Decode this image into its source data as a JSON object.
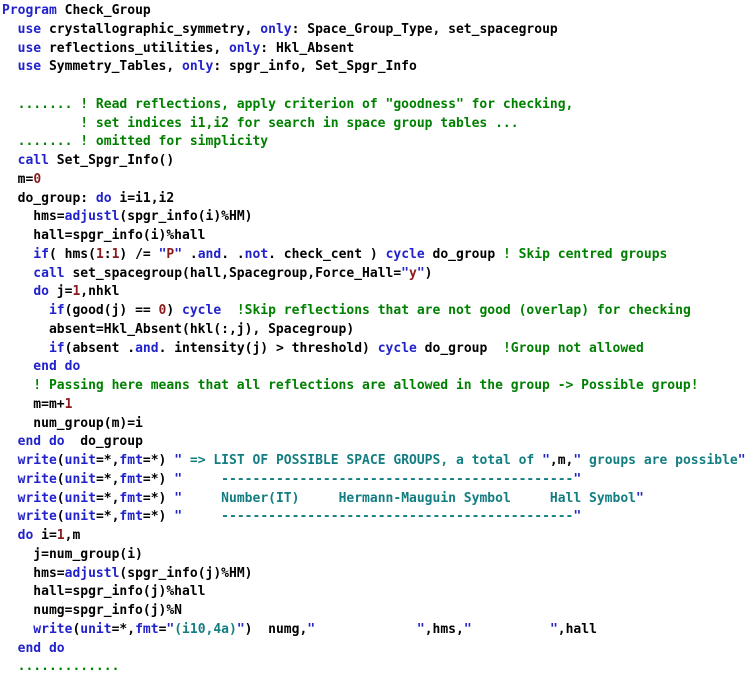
{
  "window": {
    "title": "Check_Group",
    "language": "Fortran",
    "background_color": "#ffffff"
  },
  "theme": {
    "keyword_color": "#2222cc",
    "comment_color": "#008000",
    "number_color": "#8b1a1a",
    "string_literal_color": "#8b1a1a",
    "format_string_color": "#127e82",
    "plain_text_color": "#000000",
    "quote_color": "#2222cc"
  },
  "code": {
    "line_count": 29,
    "lines": [
      [
        {
          "t": "kw",
          "s": "Program"
        },
        {
          "t": "plain",
          "s": " Check_Group"
        }
      ],
      [
        {
          "t": "plain",
          "s": "  "
        },
        {
          "t": "kw",
          "s": "use"
        },
        {
          "t": "plain",
          "s": " crystallographic_symmetry, "
        },
        {
          "t": "kw",
          "s": "only"
        },
        {
          "t": "plain",
          "s": ": Space_Group_Type, set_spacegroup"
        }
      ],
      [
        {
          "t": "plain",
          "s": "  "
        },
        {
          "t": "kw",
          "s": "use"
        },
        {
          "t": "plain",
          "s": " reflections_utilities, "
        },
        {
          "t": "kw",
          "s": "only"
        },
        {
          "t": "plain",
          "s": ": Hkl_Absent"
        }
      ],
      [
        {
          "t": "plain",
          "s": "  "
        },
        {
          "t": "kw",
          "s": "use"
        },
        {
          "t": "plain",
          "s": " Symmetry_Tables, "
        },
        {
          "t": "kw",
          "s": "only"
        },
        {
          "t": "plain",
          "s": ": spgr_info, Set_Spgr_Info"
        }
      ],
      [
        {
          "t": "plain",
          "s": ""
        }
      ],
      [
        {
          "t": "cmt",
          "s": "  ....... ! Read reflections, apply criterion of \"goodness\" for checking,"
        }
      ],
      [
        {
          "t": "cmt",
          "s": "          ! set indices i1,i2 for search in space group tables ..."
        }
      ],
      [
        {
          "t": "cmt",
          "s": "  ....... ! omitted for simplicity"
        }
      ],
      [
        {
          "t": "kw",
          "s": "  call"
        },
        {
          "t": "plain",
          "s": " Set_Spgr_Info()"
        }
      ],
      [
        {
          "t": "plain",
          "s": "  m="
        },
        {
          "t": "num",
          "s": "0"
        }
      ],
      [
        {
          "t": "plain",
          "s": "  do_group: "
        },
        {
          "t": "kw",
          "s": "do"
        },
        {
          "t": "plain",
          "s": " i=i1,i2"
        }
      ],
      [
        {
          "t": "plain",
          "s": "    hms="
        },
        {
          "t": "kw",
          "s": "adjustl"
        },
        {
          "t": "plain",
          "s": "(spgr_info(i)%HM)"
        }
      ],
      [
        {
          "t": "plain",
          "s": "    hall=spgr_info(i)%hall"
        }
      ],
      [
        {
          "t": "kw",
          "s": "    if"
        },
        {
          "t": "plain",
          "s": "( hms("
        },
        {
          "t": "num",
          "s": "1"
        },
        {
          "t": "plain",
          "s": ":"
        },
        {
          "t": "num",
          "s": "1"
        },
        {
          "t": "plain",
          "s": ") /= "
        },
        {
          "t": "strq",
          "s": "\""
        },
        {
          "t": "str",
          "s": "P"
        },
        {
          "t": "strq",
          "s": "\""
        },
        {
          "t": "plain",
          "s": " ."
        },
        {
          "t": "kw",
          "s": "and"
        },
        {
          "t": "plain",
          "s": ". ."
        },
        {
          "t": "kw",
          "s": "not"
        },
        {
          "t": "plain",
          "s": ". check_cent ) "
        },
        {
          "t": "kw",
          "s": "cycle"
        },
        {
          "t": "plain",
          "s": " do_group "
        },
        {
          "t": "cmt",
          "s": "! Skip centred groups"
        }
      ],
      [
        {
          "t": "kw",
          "s": "    call"
        },
        {
          "t": "plain",
          "s": " set_spacegroup(hall,Spacegroup,Force_Hall="
        },
        {
          "t": "strq",
          "s": "\""
        },
        {
          "t": "str",
          "s": "y"
        },
        {
          "t": "strq",
          "s": "\""
        },
        {
          "t": "plain",
          "s": ")"
        }
      ],
      [
        {
          "t": "plain",
          "s": "    "
        },
        {
          "t": "kw",
          "s": "do"
        },
        {
          "t": "plain",
          "s": " j="
        },
        {
          "t": "num",
          "s": "1"
        },
        {
          "t": "plain",
          "s": ",nhkl"
        }
      ],
      [
        {
          "t": "kw",
          "s": "      if"
        },
        {
          "t": "plain",
          "s": "(good(j) == "
        },
        {
          "t": "num",
          "s": "0"
        },
        {
          "t": "plain",
          "s": ") "
        },
        {
          "t": "kw",
          "s": "cycle"
        },
        {
          "t": "plain",
          "s": "  "
        },
        {
          "t": "cmt",
          "s": "!Skip reflections that are not good (overlap) for checking"
        }
      ],
      [
        {
          "t": "plain",
          "s": "      absent=Hkl_Absent(hkl(:,j), Spacegroup)"
        }
      ],
      [
        {
          "t": "kw",
          "s": "      if"
        },
        {
          "t": "plain",
          "s": "(absent ."
        },
        {
          "t": "kw",
          "s": "and"
        },
        {
          "t": "plain",
          "s": ". intensity(j) > threshold) "
        },
        {
          "t": "kw",
          "s": "cycle"
        },
        {
          "t": "plain",
          "s": " do_group  "
        },
        {
          "t": "cmt",
          "s": "!Group not allowed"
        }
      ],
      [
        {
          "t": "kw",
          "s": "    end do"
        }
      ],
      [
        {
          "t": "cmt",
          "s": "    ! Passing here means that all reflections are allowed in the group -> Possible group!"
        }
      ],
      [
        {
          "t": "plain",
          "s": "    m=m+"
        },
        {
          "t": "num",
          "s": "1"
        }
      ],
      [
        {
          "t": "plain",
          "s": "    num_group(m)=i"
        }
      ],
      [
        {
          "t": "kw",
          "s": "  end do"
        },
        {
          "t": "plain",
          "s": "  do_group"
        }
      ],
      [
        {
          "t": "kw",
          "s": "  write"
        },
        {
          "t": "plain",
          "s": "("
        },
        {
          "t": "kw",
          "s": "unit"
        },
        {
          "t": "plain",
          "s": "=*,"
        },
        {
          "t": "kw",
          "s": "fmt"
        },
        {
          "t": "plain",
          "s": "=*) "
        },
        {
          "t": "strq",
          "s": "\""
        },
        {
          "t": "fstr",
          "s": " => LIST OF POSSIBLE SPACE GROUPS, a total of "
        },
        {
          "t": "strq",
          "s": "\""
        },
        {
          "t": "plain",
          "s": ",m,"
        },
        {
          "t": "strq",
          "s": "\""
        },
        {
          "t": "fstr",
          "s": " groups are possible"
        },
        {
          "t": "strq",
          "s": "\""
        }
      ],
      [
        {
          "t": "kw",
          "s": "  write"
        },
        {
          "t": "plain",
          "s": "("
        },
        {
          "t": "kw",
          "s": "unit"
        },
        {
          "t": "plain",
          "s": "=*,"
        },
        {
          "t": "kw",
          "s": "fmt"
        },
        {
          "t": "plain",
          "s": "=*) "
        },
        {
          "t": "strq",
          "s": "\""
        },
        {
          "t": "fstr",
          "s": "     ---------------------------------------------"
        },
        {
          "t": "strq",
          "s": "\""
        }
      ],
      [
        {
          "t": "kw",
          "s": "  write"
        },
        {
          "t": "plain",
          "s": "("
        },
        {
          "t": "kw",
          "s": "unit"
        },
        {
          "t": "plain",
          "s": "=*,"
        },
        {
          "t": "kw",
          "s": "fmt"
        },
        {
          "t": "plain",
          "s": "=*) "
        },
        {
          "t": "strq",
          "s": "\""
        },
        {
          "t": "fstr",
          "s": "     Number(IT)     Hermann-Mauguin Symbol     Hall Symbol"
        },
        {
          "t": "strq",
          "s": "\""
        }
      ],
      [
        {
          "t": "kw",
          "s": "  write"
        },
        {
          "t": "plain",
          "s": "("
        },
        {
          "t": "kw",
          "s": "unit"
        },
        {
          "t": "plain",
          "s": "=*,"
        },
        {
          "t": "kw",
          "s": "fmt"
        },
        {
          "t": "plain",
          "s": "=*) "
        },
        {
          "t": "strq",
          "s": "\""
        },
        {
          "t": "fstr",
          "s": "     ---------------------------------------------"
        },
        {
          "t": "strq",
          "s": "\""
        }
      ],
      [
        {
          "t": "plain",
          "s": "  "
        },
        {
          "t": "kw",
          "s": "do"
        },
        {
          "t": "plain",
          "s": " i="
        },
        {
          "t": "num",
          "s": "1"
        },
        {
          "t": "plain",
          "s": ",m"
        }
      ],
      [
        {
          "t": "plain",
          "s": "    j=num_group(i)"
        }
      ],
      [
        {
          "t": "plain",
          "s": "    hms="
        },
        {
          "t": "kw",
          "s": "adjustl"
        },
        {
          "t": "plain",
          "s": "(spgr_info(j)%HM)"
        }
      ],
      [
        {
          "t": "plain",
          "s": "    hall=spgr_info(j)%hall"
        }
      ],
      [
        {
          "t": "plain",
          "s": "    numg=spgr_info(j)%N"
        }
      ],
      [
        {
          "t": "kw",
          "s": "    write"
        },
        {
          "t": "plain",
          "s": "("
        },
        {
          "t": "kw",
          "s": "unit"
        },
        {
          "t": "plain",
          "s": "=*,"
        },
        {
          "t": "kw",
          "s": "fmt"
        },
        {
          "t": "plain",
          "s": "="
        },
        {
          "t": "strq",
          "s": "\""
        },
        {
          "t": "fstr",
          "s": "(i10,4a)"
        },
        {
          "t": "strq",
          "s": "\""
        },
        {
          "t": "plain",
          "s": ")  numg,"
        },
        {
          "t": "strq",
          "s": "\""
        },
        {
          "t": "fstr",
          "s": "             "
        },
        {
          "t": "strq",
          "s": "\""
        },
        {
          "t": "plain",
          "s": ",hms,"
        },
        {
          "t": "strq",
          "s": "\""
        },
        {
          "t": "fstr",
          "s": "          "
        },
        {
          "t": "strq",
          "s": "\""
        },
        {
          "t": "plain",
          "s": ",hall"
        }
      ],
      [
        {
          "t": "kw",
          "s": "  end do"
        }
      ],
      [
        {
          "t": "cmt",
          "s": "  ............."
        }
      ]
    ]
  }
}
